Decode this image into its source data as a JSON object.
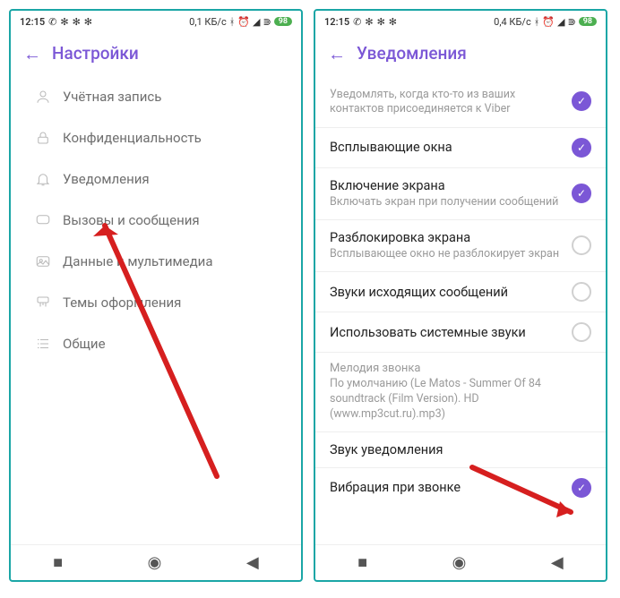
{
  "left": {
    "status": {
      "time": "12:15",
      "data": "0,1 КБ/с",
      "battery": "98"
    },
    "title": "Настройки",
    "items": [
      {
        "label": "Учётная запись",
        "icon": "user-icon"
      },
      {
        "label": "Конфиденциальность",
        "icon": "lock-icon"
      },
      {
        "label": "Уведомления",
        "icon": "bell-icon"
      },
      {
        "label": "Вызовы и сообщения",
        "icon": "chat-icon"
      },
      {
        "label": "Данные и мультимедиа",
        "icon": "media-icon"
      },
      {
        "label": "Темы оформления",
        "icon": "brush-icon"
      },
      {
        "label": "Общие",
        "icon": "list-icon"
      }
    ]
  },
  "right": {
    "status": {
      "time": "12:15",
      "data": "0,4 КБ/с",
      "battery": "98"
    },
    "title": "Уведомления",
    "rows": [
      {
        "title": "",
        "sub": "Уведомлять, когда кто-то из ваших контактов присоединяется к Viber",
        "on": true
      },
      {
        "title": "Всплывающие окна",
        "sub": "",
        "on": true
      },
      {
        "title": "Включение экрана",
        "sub": "Включать экран при получении сообщений",
        "on": true
      },
      {
        "title": "Разблокировка экрана",
        "sub": "Всплывающее окно не разблокирует экран",
        "on": false
      },
      {
        "title": "Звуки исходящих сообщений",
        "sub": "",
        "on": false
      },
      {
        "title": "Использовать системные звуки",
        "sub": "",
        "on": false
      }
    ],
    "ringtone": {
      "header": "Мелодия звонка",
      "sub": "По умолчанию (Le Matos - Summer Of 84 soundtrack (Film Version). HD (www.mp3cut.ru).mp3)"
    },
    "extra": [
      {
        "title": "Звук уведомления",
        "on": null
      },
      {
        "title": "Вибрация при звонке",
        "on": true
      }
    ]
  },
  "colors": {
    "accent": "#7b57d6"
  }
}
